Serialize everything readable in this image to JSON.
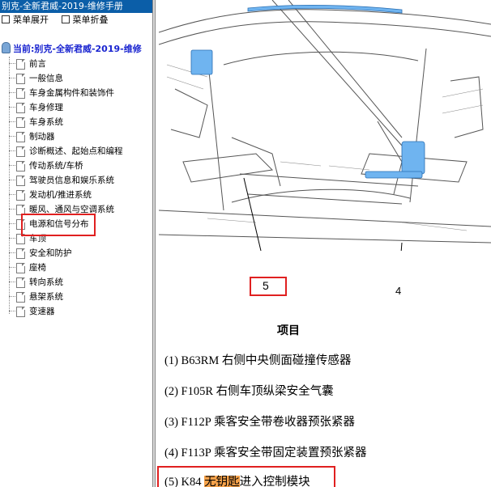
{
  "window_title": "别克-全新君威-2019-维修手册",
  "toolbar": {
    "expand_label": "菜单展开",
    "collapse_label": "菜单折叠"
  },
  "tree": {
    "current_label": "当前:别克-全新君威-2019-维修",
    "items": [
      "前言",
      "一般信息",
      "车身金属构件和装饰件",
      "车身修理",
      "车身系统",
      "制动器",
      "诊断概述、起始点和编程",
      "传动系统/车桥",
      "驾驶员信息和娱乐系统",
      "发动机/推进系统",
      "暖风、通风与空调系统",
      "电源和信号分布",
      "车顶",
      "安全和防护",
      "座椅",
      "转向系统",
      "悬架系统",
      "变速器"
    ],
    "highlighted_index": 11
  },
  "diagram": {
    "callout_5": "5",
    "callout_4": "4"
  },
  "items_section": {
    "heading": "项目",
    "items": [
      "(1) B63RM 右侧中央侧面碰撞传感器",
      "(2) F105R 右侧车顶纵梁安全气囊",
      "(3) F112P 乘客安全带卷收器预张紧器",
      "(4) F113P 乘客安全带固定装置预张紧器"
    ],
    "item5_prefix": "(5) K84 ",
    "item5_highlight": "无钥匙",
    "item5_suffix": "进入控制模块"
  },
  "colors": {
    "title_bar": "#0b5ea8",
    "highlight_box": "#e02020",
    "search_highlight": "#f6a24a",
    "component_blue": "#6fb4f0"
  }
}
